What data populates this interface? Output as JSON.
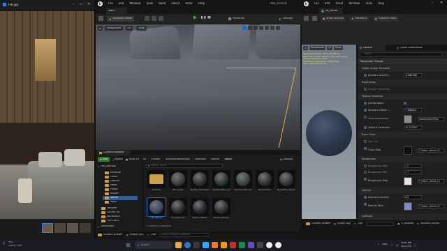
{
  "photo_viewer": {
    "filename": "FHI.jpg"
  },
  "taskbar": {
    "weather_temp": "9°C",
    "weather_desc": "Mostly clear",
    "search_placeholder": "Search",
    "lang": "ENG",
    "clock_time": "9:30 PM",
    "clock_date": "4/2/2024"
  },
  "ue": {
    "project": "FHB_ArchvIz",
    "menus": [
      "File",
      "Edit",
      "Window",
      "Tools",
      "Build",
      "Select",
      "Actor",
      "Help"
    ],
    "level_tab": "Main*",
    "toolbar": {
      "mode": "Selection Mode",
      "platforms": "Platforms",
      "settings": "Settings"
    },
    "viewport": {
      "perspective": "Perspective",
      "lit": "Lit",
      "show": "Show"
    }
  },
  "content_browser": {
    "tab": "Content Browser",
    "add": "Add",
    "import": "Import",
    "save_all": "Save All",
    "path": [
      "All",
      "Content",
      "AutomotiveMaterials",
      "Materials",
      "Interior",
      "Textile"
    ],
    "settings": "Settings",
    "search_placeholder": "Search Textile",
    "tree_root": "FHB_Archviz",
    "tree": [
      "Emissive",
      "Filters",
      "Leather",
      "Metal",
      "Plastic",
      "Rubber",
      "Textile",
      "Wood"
    ],
    "tree_bottom": [
      "Textures",
      "GEOMETRY",
      "MATERIALS",
      "TEXTURES"
    ],
    "collections": "Collections",
    "item_count": "11 items (1 selected)",
    "items": [
      {
        "label": "Textures",
        "kind": "folder",
        "color": "#c8a050"
      },
      {
        "label": "MI_Carpet",
        "kind": "sphere",
        "color": "#3b4047"
      },
      {
        "label": "MI_Felt_Perforated",
        "kind": "sphere",
        "color": "#2e3238"
      },
      {
        "label": "MI_Microfiber_01",
        "kind": "sphere",
        "color": "#2a3a33"
      },
      {
        "label": "MI_Polyester_01",
        "kind": "sphere",
        "color": "#3a4a3e"
      },
      {
        "label": "MI_Suede01",
        "kind": "sphere",
        "color": "#333"
      },
      {
        "label": "MI_Textile_Woven",
        "kind": "sphere",
        "color": "#363636"
      },
      {
        "label": "MI_Velvet",
        "kind": "sphere",
        "color": "#3a4a66"
      },
      {
        "label": "MI_Velvet_02",
        "kind": "sphere",
        "color": "#2c2c2c"
      },
      {
        "label": "Textile_Master",
        "kind": "sphere",
        "color": "#262a30"
      },
      {
        "label": "Textile_Params",
        "kind": "sphere",
        "color": "#2f3035"
      }
    ],
    "drawer": "Content Drawer",
    "output_log": "Output Log",
    "cmd": "Cmd",
    "console_placeholder": "Enter Console Command"
  },
  "material_editor": {
    "menus": [
      "File",
      "Edit",
      "Asset",
      "Window",
      "Tools",
      "Help"
    ],
    "tab": "MI_Velvet",
    "toolbar": [
      "Save",
      "Browse",
      "Show Inactive",
      "Hierarchy",
      "Platform Stats"
    ],
    "preview": {
      "perspective": "Perspective",
      "lit": "Lit",
      "show": "Show"
    },
    "preview_stats": [
      "Base pass shader: 205 instructions",
      "Base pass vertex shader: 104 instructions",
      "Texture samplers: 6/16",
      "Texture Lookups (Est.): VS(0) PS(6)",
      "User interpolators: 2/4"
    ],
    "details_tab": "Details",
    "layer_tab": "Layer Parameters",
    "search_placeholder": "Search",
    "sections": {
      "param_groups": "Parameter Groups",
      "global_scalar": "Global Scalar Paramet",
      "raytracing": "Raytracing",
      "texture_variation": "Texture Variation",
      "base_color": "Base Color",
      "roughness": "Roughness",
      "normal": "Normal",
      "softness": "Softness"
    },
    "params": {
      "random_seed": {
        "label": "Random Seed O...",
        "value": "-4.681368"
      },
      "enable_refl": {
        "label": "Enable Reflection..."
      },
      "use_variation": {
        "label": "UseVariation"
      },
      "random_offset": {
        "label": "Random Offset ...",
        "value": "7.788814"
      },
      "texture_variation_map": {
        "label": "TextureVariation",
        "value": "CoolVariationMap"
      },
      "texture_variation_amt": {
        "label": "Texture Variation...",
        "value": "12.747997"
      },
      "use_tint": {
        "label": "Use Tint"
      },
      "color_map": {
        "label": "Color Map",
        "value": "T_Fabric_Velvet_01"
      },
      "roughness_max": {
        "label": "Roughness Max",
        "value": "0.8"
      },
      "roughness_min": {
        "label": "Roughness Min",
        "value": "0.3"
      },
      "roughness_map": {
        "label": "Roughness Map",
        "value": "T_Fabric_Velvet_01"
      },
      "normal_intensity": {
        "label": "Normal Intensity",
        "value": "0.5"
      },
      "normal_map": {
        "label": "Normal Map",
        "value": "T_Fabric_Velvet_01"
      }
    },
    "bottom": {
      "drawer": "Content Drawer",
      "output_log": "Output Log",
      "cmd": "Cmd",
      "unsaved": "1 Unsaved",
      "revision": "Revision Control"
    }
  },
  "colors": {
    "accent": "#0a70d8",
    "ue_bg": "#151515",
    "panel": "#1f1f1f",
    "play": "#3cb043",
    "fabric": "#2f3a4e"
  }
}
